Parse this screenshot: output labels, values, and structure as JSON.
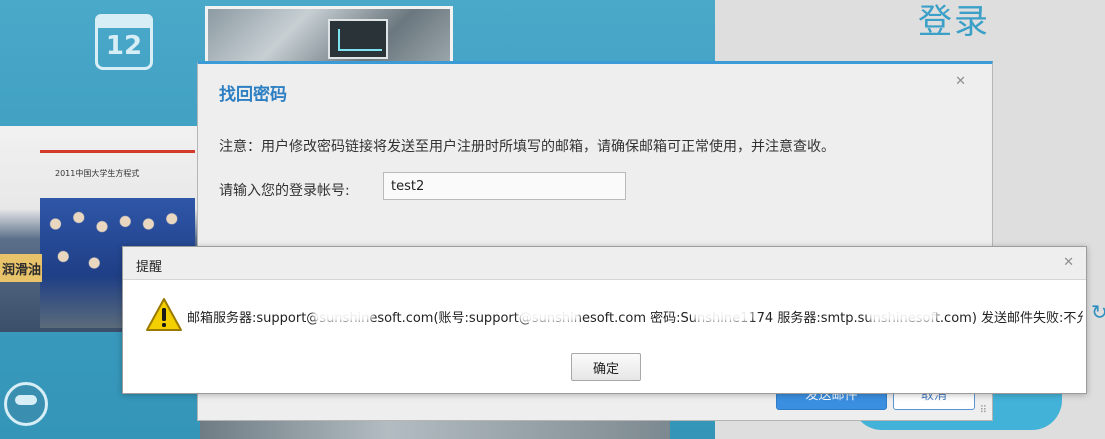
{
  "background": {
    "calendar_icon_text": "12",
    "team_photo_sign": "润滑油",
    "team_photo_banner": "2011中国大学生方程式",
    "login_title": "登录",
    "reload_glyph": "↻"
  },
  "find_password_dialog": {
    "title": "找回密码",
    "close_glyph": "✕",
    "notice": "注意：用户修改密码链接将发送至用户注册时所填写的邮箱，请确保邮箱可正常使用，并注意查收。",
    "account_label": "请输入您的登录帐号:",
    "account_value": "test2",
    "send_button": "发送邮件",
    "cancel_button": "取消"
  },
  "alert_dialog": {
    "title": "提醒",
    "close_glyph": "✕",
    "icon": "warning-icon",
    "message": "邮箱服务器:support@sunshinesoft.com(账号:support@sunshinesoft.com 密码:Sunshine1174 服务器:smtp.sunshinesoft.com) 发送邮件失败:不允许",
    "ok_button": "确定"
  },
  "colors": {
    "accent_blue": "#3b9bd6",
    "title_blue": "#2d7fc4",
    "warning_yellow": "#f5d000"
  }
}
